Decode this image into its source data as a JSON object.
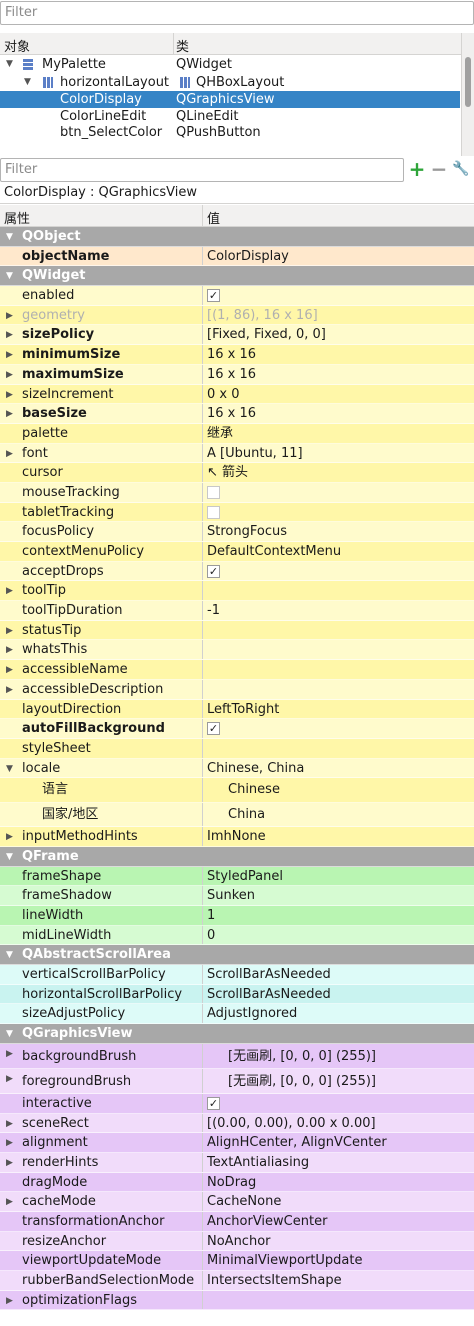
{
  "object_inspector": {
    "filter_placeholder": "Filter",
    "col_object": "对象",
    "col_class": "类",
    "rows": [
      {
        "name": "MyPalette",
        "cls": "QWidget"
      },
      {
        "name": "horizontalLayout",
        "cls": "QHBoxLayout"
      },
      {
        "name": "ColorDisplay",
        "cls": "QGraphicsView"
      },
      {
        "name": "ColorLineEdit",
        "cls": "QLineEdit"
      },
      {
        "name": "btn_SelectColor",
        "cls": "QPushButton"
      }
    ]
  },
  "property_editor": {
    "filter_placeholder": "Filter",
    "add_glyph": "+",
    "remove_glyph": "−",
    "config_glyph": "🔧",
    "breadcrumb": "ColorDisplay : QGraphicsView",
    "col_property": "属性",
    "col_value": "值",
    "rows": [
      {
        "n": "QObject"
      },
      {
        "n": "objectName",
        "v": "ColorDisplay"
      },
      {
        "n": "QWidget"
      },
      {
        "n": "enabled",
        "v": "✓"
      },
      {
        "n": "geometry",
        "v": "[(1, 86), 16 x 16]"
      },
      {
        "n": "sizePolicy",
        "v": "[Fixed, Fixed, 0, 0]"
      },
      {
        "n": "minimumSize",
        "v": "16 x 16"
      },
      {
        "n": "maximumSize",
        "v": "16 x 16"
      },
      {
        "n": "sizeIncrement",
        "v": "0 x 0"
      },
      {
        "n": "baseSize",
        "v": "16 x 16"
      },
      {
        "n": "palette",
        "v": "继承"
      },
      {
        "n": "font",
        "v": "A  [Ubuntu, 11]"
      },
      {
        "n": "cursor",
        "v": "↖  箭头"
      },
      {
        "n": "mouseTracking",
        "v": ""
      },
      {
        "n": "tabletTracking",
        "v": ""
      },
      {
        "n": "focusPolicy",
        "v": "StrongFocus"
      },
      {
        "n": "contextMenuPolicy",
        "v": "DefaultContextMenu"
      },
      {
        "n": "acceptDrops",
        "v": "✓"
      },
      {
        "n": "toolTip",
        "v": ""
      },
      {
        "n": "toolTipDuration",
        "v": "-1"
      },
      {
        "n": "statusTip",
        "v": ""
      },
      {
        "n": "whatsThis",
        "v": ""
      },
      {
        "n": "accessibleName",
        "v": ""
      },
      {
        "n": "accessibleDescription",
        "v": ""
      },
      {
        "n": "layoutDirection",
        "v": "LeftToRight"
      },
      {
        "n": "autoFillBackground",
        "v": "✓"
      },
      {
        "n": "styleSheet",
        "v": ""
      },
      {
        "n": "locale",
        "v": "Chinese, China"
      },
      {
        "n": "语言",
        "v": "Chinese"
      },
      {
        "n": "国家/地区",
        "v": "China"
      },
      {
        "n": "inputMethodHints",
        "v": "ImhNone"
      },
      {
        "n": "QFrame"
      },
      {
        "n": "frameShape",
        "v": "StyledPanel"
      },
      {
        "n": "frameShadow",
        "v": "Sunken"
      },
      {
        "n": "lineWidth",
        "v": "1"
      },
      {
        "n": "midLineWidth",
        "v": "0"
      },
      {
        "n": "QAbstractScrollArea"
      },
      {
        "n": "verticalScrollBarPolicy",
        "v": "ScrollBarAsNeeded"
      },
      {
        "n": "horizontalScrollBarPolicy",
        "v": "ScrollBarAsNeeded"
      },
      {
        "n": "sizeAdjustPolicy",
        "v": "AdjustIgnored"
      },
      {
        "n": "QGraphicsView"
      },
      {
        "n": "backgroundBrush",
        "v": "[无画刷, [0, 0, 0] (255)]"
      },
      {
        "n": "foregroundBrush",
        "v": "[无画刷, [0, 0, 0] (255)]"
      },
      {
        "n": "interactive",
        "v": "✓"
      },
      {
        "n": "sceneRect",
        "v": "[(0.00, 0.00), 0.00 x 0.00]"
      },
      {
        "n": "alignment",
        "v": "AlignHCenter, AlignVCenter"
      },
      {
        "n": "renderHints",
        "v": "TextAntialiasing"
      },
      {
        "n": "dragMode",
        "v": "NoDrag"
      },
      {
        "n": "cacheMode",
        "v": "CacheNone"
      },
      {
        "n": "transformationAnchor",
        "v": "AnchorViewCenter"
      },
      {
        "n": "resizeAnchor",
        "v": "NoAnchor"
      },
      {
        "n": "viewportUpdateMode",
        "v": "MinimalViewportUpdate"
      },
      {
        "n": "rubberBandSelectionMode",
        "v": "IntersectsItemShape"
      },
      {
        "n": "optimizationFlags",
        "v": ""
      }
    ]
  }
}
